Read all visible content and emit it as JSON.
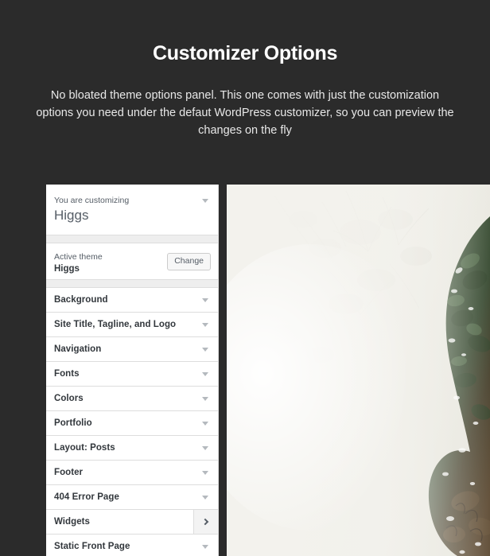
{
  "hero": {
    "title": "Customizer Options",
    "subtitle": "No bloated theme options panel. This one comes with just the customization options you need under the defaut WordPress customizer, so you can preview the changes on the fly",
    "background_color": "#2b2b2b",
    "title_color": "#ffffff",
    "subtitle_color": "#e8e8e8"
  },
  "customizer": {
    "header": {
      "label": "You are customizing",
      "site_name": "Higgs",
      "collapse_icon": "caret-down-icon"
    },
    "active_theme": {
      "label": "Active theme",
      "name": "Higgs",
      "change_button": "Change"
    },
    "sections": [
      {
        "label": "Background",
        "icon": "caret-down-icon",
        "state": "default"
      },
      {
        "label": "Site Title, Tagline, and Logo",
        "icon": "caret-down-icon",
        "state": "default"
      },
      {
        "label": "Navigation",
        "icon": "caret-down-icon",
        "state": "default"
      },
      {
        "label": "Fonts",
        "icon": "caret-down-icon",
        "state": "default"
      },
      {
        "label": "Colors",
        "icon": "caret-down-icon",
        "state": "default"
      },
      {
        "label": "Portfolio",
        "icon": "caret-down-icon",
        "state": "default"
      },
      {
        "label": "Layout: Posts",
        "icon": "caret-down-icon",
        "state": "default"
      },
      {
        "label": "Footer",
        "icon": "caret-down-icon",
        "state": "default"
      },
      {
        "label": "404 Error Page",
        "icon": "caret-down-icon",
        "state": "default"
      },
      {
        "label": "Widgets",
        "icon": "chevron-right-icon",
        "state": "active"
      },
      {
        "label": "Static Front Page",
        "icon": "caret-down-icon",
        "state": "default"
      }
    ],
    "colors": {
      "panel_background": "#ffffff",
      "border": "#dddddd",
      "band": "#eeeeee",
      "text_dark": "#32373c",
      "text_muted": "#555d66",
      "icon_gray": "#b4b9be",
      "active_row": "#f3f3f3"
    },
    "preview": {
      "description": "Faded misty photograph with green foliage along the right edge fading to brown earth tones at the bottom",
      "colors": {
        "mist": "#f2f1ec",
        "foliage_dark": "#33462f",
        "foliage_mid": "#4a6344",
        "earth": "#5b4632"
      }
    }
  }
}
